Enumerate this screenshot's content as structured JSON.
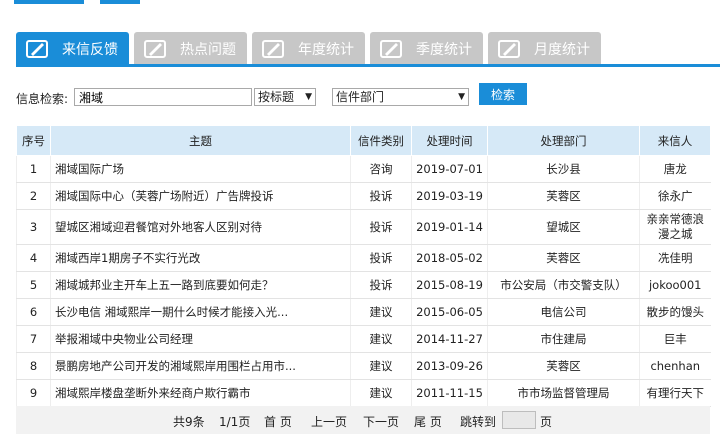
{
  "tabs": [
    {
      "label": "来信反馈",
      "icon": "feedback-icon",
      "active": true
    },
    {
      "label": "热点问题",
      "icon": "hot-topic-icon",
      "active": false
    },
    {
      "label": "年度统计",
      "icon": "annual-stats-icon",
      "active": false
    },
    {
      "label": "季度统计",
      "icon": "quarter-stats-icon",
      "active": false
    },
    {
      "label": "月度统计",
      "icon": "month-stats-icon",
      "active": false
    }
  ],
  "search": {
    "label": "信息检索:",
    "keyword": "湘域",
    "field_select": "按标题",
    "dept_select": "信件部门",
    "button": "检索"
  },
  "table": {
    "headers": [
      "序号",
      "主题",
      "信件类别",
      "处理时间",
      "处理部门",
      "来信人"
    ],
    "rows": [
      [
        "1",
        "湘域国际广场",
        "咨询",
        "2019-07-01",
        "长沙县",
        "唐龙"
      ],
      [
        "2",
        "湘域国际中心（芙蓉广场附近）广告牌投诉",
        "投诉",
        "2019-03-19",
        "芙蓉区",
        "徐永广"
      ],
      [
        "3",
        "望城区湘域迎君餐馆对外地客人区别对待",
        "投诉",
        "2019-01-14",
        "望城区",
        "亲亲常德浪漫之城"
      ],
      [
        "4",
        "湘域西岸1期房子不实行光改",
        "投诉",
        "2018-05-02",
        "芙蓉区",
        "冼佳明"
      ],
      [
        "5",
        "湘域城邦业主开车上五一路到底要如何走？",
        "投诉",
        "2015-08-19",
        "市公安局（市交警支队）",
        "jokoo001"
      ],
      [
        "6",
        "长沙电信 湘域熙岸一期什么时候才能接入光...",
        "建议",
        "2015-06-05",
        "电信公司",
        "散步的馒头"
      ],
      [
        "7",
        "举报湘域中央物业公司经理",
        "建议",
        "2014-11-27",
        "市住建局",
        "巨丰"
      ],
      [
        "8",
        "景鹏房地产公司开发的湘域熙岸用围栏占用市...",
        "建议",
        "2013-09-26",
        "芙蓉区",
        "chenhan"
      ],
      [
        "9",
        "湘域熙岸楼盘垄断外来经商户欺行霸市",
        "建议",
        "2011-11-15",
        "市市场监督管理局",
        "有理行天下"
      ]
    ]
  },
  "pager": {
    "total": "共9条",
    "pages": "1/1页",
    "first": "首 页",
    "prev": "上一页",
    "next": "下一页",
    "last": "尾 页",
    "jump_label": "跳转到",
    "page_suffix": "页"
  },
  "colors": {
    "accent": "#1a8dd8",
    "tab_inactive": "#c7c7c7",
    "header_bg": "#d6e9f7"
  }
}
